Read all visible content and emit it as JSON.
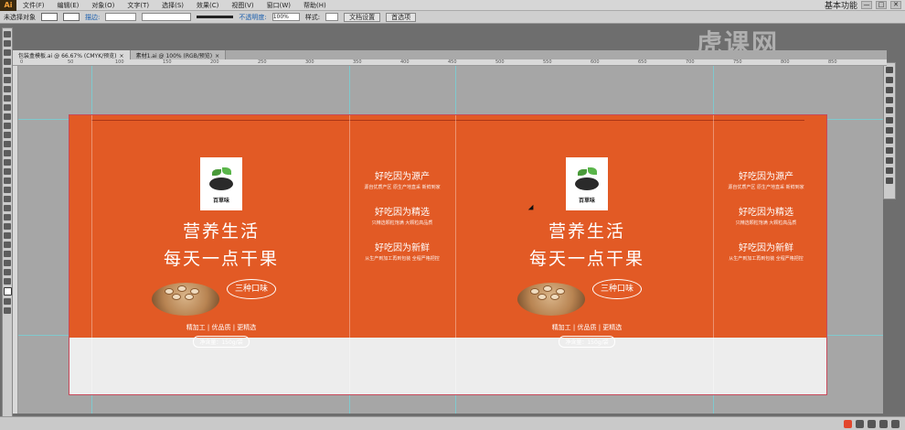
{
  "app": {
    "logo": "Ai"
  },
  "menu": [
    "文件(F)",
    "编辑(E)",
    "对象(O)",
    "文字(T)",
    "选择(S)",
    "效果(C)",
    "视图(V)",
    "窗口(W)",
    "帮助(H)"
  ],
  "window_controls": [
    "—",
    "□",
    "✕"
  ],
  "workspace_label": "基本功能",
  "control_bar": {
    "selection": "未选择对象",
    "stroke_label": "描边:",
    "opacity_label": "不透明度:",
    "opacity_value": "100%",
    "style_label": "样式:",
    "doc_setup": "文档设置",
    "prefs": "首选项"
  },
  "tabs": [
    {
      "label": "包装盒模板.ai @ 66.67% (CMYK/预览)",
      "active": true
    },
    {
      "label": "素材1.ai @ 100% (RGB/预览)",
      "active": false
    }
  ],
  "ruler_ticks": [
    "0",
    "50",
    "100",
    "150",
    "200",
    "250",
    "300",
    "350",
    "400",
    "450",
    "500",
    "550",
    "600",
    "650",
    "700",
    "750",
    "800",
    "850"
  ],
  "front_panels": [
    {
      "brand": "百草味",
      "slogan1": "营养生活",
      "slogan2": "每天一点干果",
      "badge": "三种口味",
      "features": "精加工 | 优品质 | 更精选",
      "weight": "净含量：150g/袋"
    },
    {
      "brand": "百草味",
      "slogan1": "营养生活",
      "slogan2": "每天一点干果",
      "badge": "三种口味",
      "features": "精加工 | 优品质 | 更精选",
      "weight": "净含量：150g/袋"
    }
  ],
  "side_panels": [
    {
      "sections": [
        {
          "title": "好吃因为源产",
          "text": "源自优质产区 原生产地直采 新鲜到家"
        },
        {
          "title": "好吃因为精选",
          "text": "只精选颗粒饱满 大颗粒高品质"
        },
        {
          "title": "好吃因为新鲜",
          "text": "从生产到加工再到包装 全程严格把控"
        }
      ]
    },
    {
      "sections": [
        {
          "title": "好吃因为源产",
          "text": "源自优质产区 原生产地直采 新鲜到家"
        },
        {
          "title": "好吃因为精选",
          "text": "只精选颗粒饱满 大颗粒高品质"
        },
        {
          "title": "好吃因为新鲜",
          "text": "从生产到加工再到包装 全程严格把控"
        }
      ]
    }
  ],
  "watermark": "虎课网",
  "colors": {
    "package_orange": "#e25a25",
    "guide": "#6fd8e0",
    "bleed": "#c7495a"
  }
}
